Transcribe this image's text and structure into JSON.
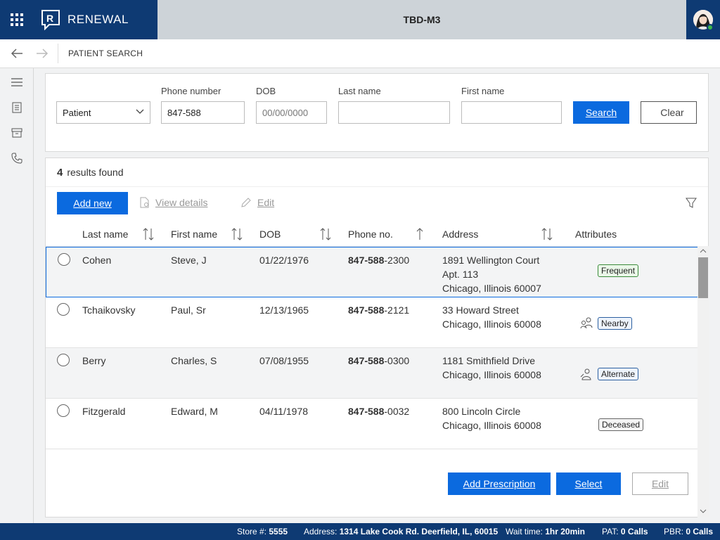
{
  "app": {
    "brand": "RENEWAL",
    "window_title": "TBD-M3"
  },
  "nav": {
    "breadcrumb": "PATIENT SEARCH"
  },
  "search": {
    "type_value": "Patient",
    "phone_label": "Phone number",
    "phone_value": "847-588",
    "dob_label": "DOB",
    "dob_placeholder": "00/00/0000",
    "last_label": "Last name",
    "first_label": "First name",
    "search_button": "Search",
    "clear_button": "Clear"
  },
  "results": {
    "count": "4",
    "count_label": "results found",
    "add_new": "Add new",
    "view_details": "View details",
    "edit": "Edit"
  },
  "columns": [
    "Last name",
    "First name",
    "DOB",
    "Phone no.",
    "Address",
    "Attributes"
  ],
  "rows": [
    {
      "last": "Cohen",
      "first": "Steve, J",
      "dob": "01/22/1976",
      "phone_bold": "847-588",
      "phone_rest": "-2300",
      "addr1": "1891 Wellington Court",
      "addr2": "Apt. 113",
      "addr3": "Chicago, Illinois 60007",
      "attribute": "Frequent",
      "attr_icon": ""
    },
    {
      "last": "Tchaikovsky",
      "first": "Paul, Sr",
      "dob": "12/13/1965",
      "phone_bold": "847-588",
      "phone_rest": "-2121",
      "addr1": "33 Howard Street",
      "addr2": "Chicago, Illinois 60008",
      "addr3": "",
      "attribute": "Nearby",
      "attr_icon": "people-icon"
    },
    {
      "last": "Berry",
      "first": "Charles, S",
      "dob": "07/08/1955",
      "phone_bold": "847-588",
      "phone_rest": "-0300",
      "addr1": "1181 Smithfield Drive",
      "addr2": "Chicago, Illinois 60008",
      "addr3": "",
      "attribute": "Alternate",
      "attr_icon": "person-swap-icon"
    },
    {
      "last": "Fitzgerald",
      "first": "Edward, M",
      "dob": "04/11/1978",
      "phone_bold": "847-588",
      "phone_rest": "-0032",
      "addr1": "800 Lincoln Circle",
      "addr2": "Chicago, Illinois 60008",
      "addr3": "",
      "attribute": "Deceased",
      "attr_icon": ""
    }
  ],
  "footer_actions": {
    "add_prescription": "Add Prescription",
    "select": "Select",
    "edit": "Edit"
  },
  "status": {
    "store_label": "Store #:",
    "store_value": "5555",
    "address_label": "Address:",
    "address_value": "1314 Lake Cook Rd. Deerfield, IL, 60015",
    "wait_label": "Wait time:",
    "wait_value": "1hr 20min",
    "pat_label": "PAT:",
    "pat_value": "0 Calls",
    "pbr_label": "PBR:",
    "pbr_value": "0 Calls"
  },
  "colors": {
    "brand": "#0e3a73",
    "accent": "#0b6adf",
    "titlebar": "#cdd3d8"
  }
}
